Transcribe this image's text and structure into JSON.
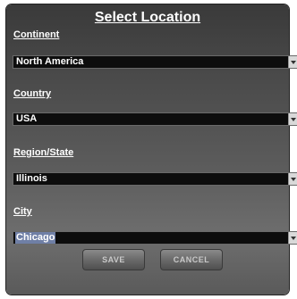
{
  "dialog": {
    "title": "Select Location",
    "continent": {
      "label": "Continent",
      "value": "North America"
    },
    "country": {
      "label": "Country",
      "value": "USA"
    },
    "region": {
      "label": "Region/State",
      "value": "Illinois"
    },
    "city": {
      "label": "City",
      "value": "Chicago"
    },
    "buttons": {
      "save": "SAVE",
      "cancel": "CANCEL"
    }
  },
  "icons": {
    "dropdown": "chevron-down-icon"
  }
}
